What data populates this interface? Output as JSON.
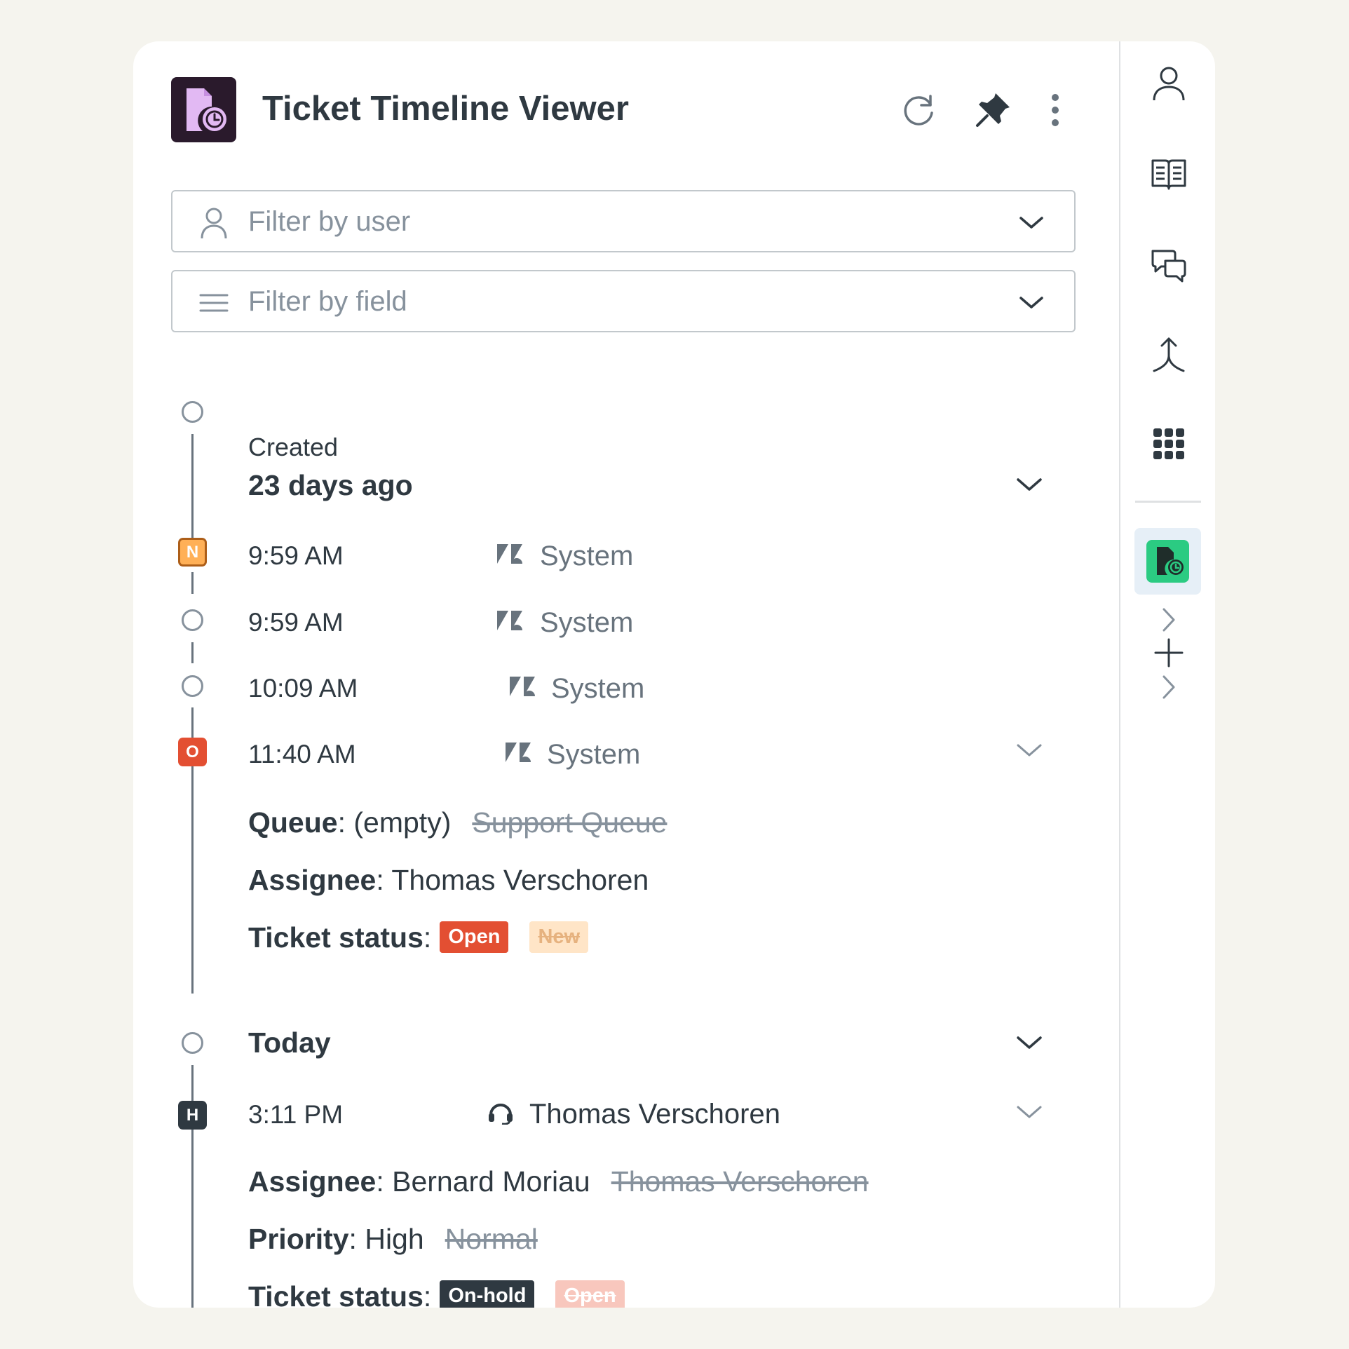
{
  "app": {
    "title": "Ticket Timeline Viewer"
  },
  "header": {
    "refresh_icon": "refresh-icon",
    "pin_icon": "pin-icon",
    "more_icon": "more-vertical-icon"
  },
  "filters": {
    "user": {
      "placeholder": "Filter by user",
      "icon": "user-icon"
    },
    "field": {
      "placeholder": "Filter by field",
      "icon": "lines-icon"
    }
  },
  "timeline": {
    "group1": {
      "label": "Created",
      "title": "23 days ago",
      "events": [
        {
          "badge": "N",
          "time": "9:59 AM",
          "user": "System",
          "expanded": false
        },
        {
          "badge": "",
          "time": "9:59 AM",
          "user": "System",
          "expanded": false
        },
        {
          "badge": "",
          "time": "10:09 AM",
          "user": "System",
          "expanded": false
        },
        {
          "badge": "O",
          "time": "11:40 AM",
          "user": "System",
          "expanded": true,
          "changes": {
            "queue": {
              "key": "Queue",
              "new": "(empty)",
              "old": "Support Queue"
            },
            "assignee": {
              "key": "Assignee",
              "new": "Thomas Verschoren"
            },
            "status": {
              "key": "Ticket status",
              "new": "Open",
              "old": "New"
            }
          }
        }
      ]
    },
    "group2": {
      "title": "Today",
      "events": [
        {
          "badge": "H",
          "time": "3:11 PM",
          "user": "Thomas Verschoren",
          "expanded": true,
          "changes": {
            "assignee": {
              "key": "Assignee",
              "new": "Bernard Moriau",
              "old": "Thomas Verschoren"
            },
            "priority": {
              "key": "Priority",
              "new": "High",
              "old": "Normal"
            },
            "status": {
              "key": "Ticket status",
              "new": "On-hold",
              "old": "Open"
            }
          }
        }
      ]
    }
  },
  "rail": {
    "icons": [
      "user-icon",
      "book-icon",
      "chat-icon",
      "merge-icon",
      "apps-grid-icon",
      "timeline-app-icon",
      "plus-icon"
    ]
  },
  "colors": {
    "accent_green": "#2bcb82",
    "status_new": "#ffb057",
    "status_open": "#e34f32",
    "status_onhold": "#2f3941",
    "logo_bg": "#2a1a2c"
  }
}
